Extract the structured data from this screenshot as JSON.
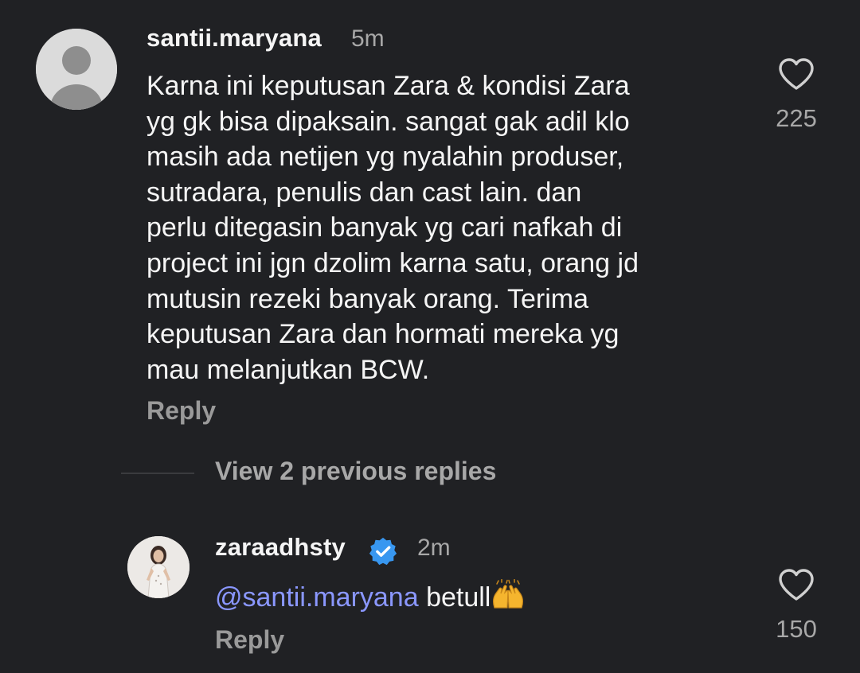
{
  "main_comment": {
    "username": "santii.maryana",
    "time": "5m",
    "text": "Karna ini keputusan Zara & kondisi Zara\nyg gk bisa dipaksain. sangat gak adil klo\nmasih ada netijen yg nyalahin produser,\nsutradara, penulis dan cast lain. dan\nperlu ditegasin banyak yg cari nafkah di\nproject ini jgn dzolim karna satu, orang jd\nmutusin rezeki banyak orang. Terima\nkeputusan Zara dan hormati mereka yg\nmau melanjutkan BCW.",
    "reply_label": "Reply",
    "like_count": "225",
    "avatar_icon": "default-avatar-icon",
    "like_icon": "heart-outline-icon"
  },
  "view_replies_label": "View 2 previous replies",
  "reply_comment": {
    "username": "zaraadhsty",
    "verified_icon": "verified-badge-icon",
    "time": "2m",
    "mention": "@santii.maryana",
    "text": " betull",
    "emoji_icon": "raising-hands-emoji",
    "reply_label": "Reply",
    "like_count": "150",
    "like_icon": "heart-outline-icon"
  },
  "colors": {
    "background": "#202124",
    "mention": "#8a97ff",
    "verified": "#3897f0",
    "muted": "#a8a8a8"
  }
}
